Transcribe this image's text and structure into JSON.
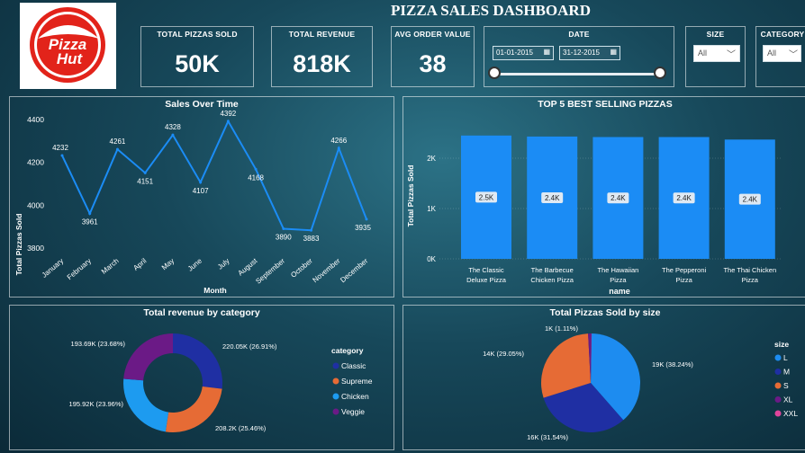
{
  "dashboard": {
    "title": "PIZZA SALES DASHBOARD"
  },
  "logo": {
    "text_line1": "Pizza",
    "text_line2": "Hut"
  },
  "kpis": [
    {
      "label": "TOTAL PIZZAS SOLD",
      "value": "50K"
    },
    {
      "label": "TOTAL REVENUE",
      "value": "818K"
    },
    {
      "label": "AVG ORDER VALUE",
      "value": "38"
    }
  ],
  "date_filter": {
    "label": "DATE",
    "start": "01-01-2015",
    "end": "31-12-2015"
  },
  "size_filter": {
    "label": "SIZE",
    "value": "All"
  },
  "category_filter": {
    "label": "CATEGORY",
    "value": "All"
  },
  "colors": {
    "line": "#1b8cf5",
    "bar": "#1b8cf5",
    "classic": "#1f2fa3",
    "supreme": "#e66b35",
    "chicken": "#1d9bf0",
    "veggie": "#6b1a86",
    "L": "#1d8cf0",
    "M": "#1f2fa3",
    "S": "#e66b35",
    "XL": "#6b1a86",
    "XXL": "#e0449b"
  },
  "chart_data": [
    {
      "type": "line",
      "title": "Sales Over Time",
      "xlabel": "Month",
      "ylabel": "Total Pizzas Sold",
      "categories": [
        "January",
        "February",
        "March",
        "April",
        "May",
        "June",
        "July",
        "August",
        "September",
        "October",
        "November",
        "December"
      ],
      "values": [
        4232,
        3961,
        4261,
        4151,
        4328,
        4107,
        4392,
        4168,
        3890,
        3883,
        4266,
        3935
      ],
      "data_labels": [
        "4232",
        "3961",
        "4261",
        "4151",
        "4328",
        "4107",
        "4392",
        "4168",
        "3890",
        "3883",
        "4266",
        "3935"
      ],
      "yticks": [
        "3800",
        "4000",
        "4200",
        "4400"
      ],
      "ylim": [
        3800,
        4400
      ]
    },
    {
      "type": "bar",
      "title": "TOP 5 BEST SELLING PIZZAS",
      "xlabel": "name",
      "ylabel": "Total Pizzas Sold",
      "categories": [
        "The Classic Deluxe Pizza",
        "The Barbecue Chicken Pizza",
        "The Hawaiian Pizza",
        "The Pepperoni Pizza",
        "The Thai Chicken Pizza"
      ],
      "category_lines": [
        [
          "The Classic",
          "Deluxe Pizza"
        ],
        [
          "The Barbecue",
          "Chicken Pizza"
        ],
        [
          "The Hawaiian",
          "Pizza"
        ],
        [
          "The Pepperoni",
          "Pizza"
        ],
        [
          "The Thai Chicken",
          "Pizza"
        ]
      ],
      "values": [
        2450,
        2430,
        2420,
        2420,
        2370
      ],
      "data_labels": [
        "2.5K",
        "2.4K",
        "2.4K",
        "2.4K",
        "2.4K"
      ],
      "yticks": [
        "0K",
        "1K",
        "2K"
      ],
      "ylim": [
        0,
        2500
      ]
    },
    {
      "type": "pie",
      "title": "Total revenue by category",
      "legend_title": "category",
      "legend_position": "right",
      "donut": true,
      "slices": [
        {
          "name": "Classic",
          "value": 220053,
          "label": "220.05K (26.91%)"
        },
        {
          "name": "Supreme",
          "value": 208197,
          "label": "208.2K (25.46%)"
        },
        {
          "name": "Chicken",
          "value": 195920,
          "label": "195.92K (23.96%)"
        },
        {
          "name": "Veggie",
          "value": 193690,
          "label": "193.69K (23.68%)"
        }
      ]
    },
    {
      "type": "pie",
      "title": "Total Pizzas Sold by size",
      "legend_title": "size",
      "legend_position": "right",
      "donut": false,
      "slices": [
        {
          "name": "L",
          "value": 38.24,
          "label": "19K (38.24%)"
        },
        {
          "name": "M",
          "value": 31.54,
          "label": "16K (31.54%)"
        },
        {
          "name": "S",
          "value": 29.05,
          "label": "14K (29.05%)"
        },
        {
          "name": "XL",
          "value": 1.11,
          "label": "1K (1.11%)"
        },
        {
          "name": "XXL",
          "value": 0.06,
          "label": ""
        }
      ]
    }
  ]
}
